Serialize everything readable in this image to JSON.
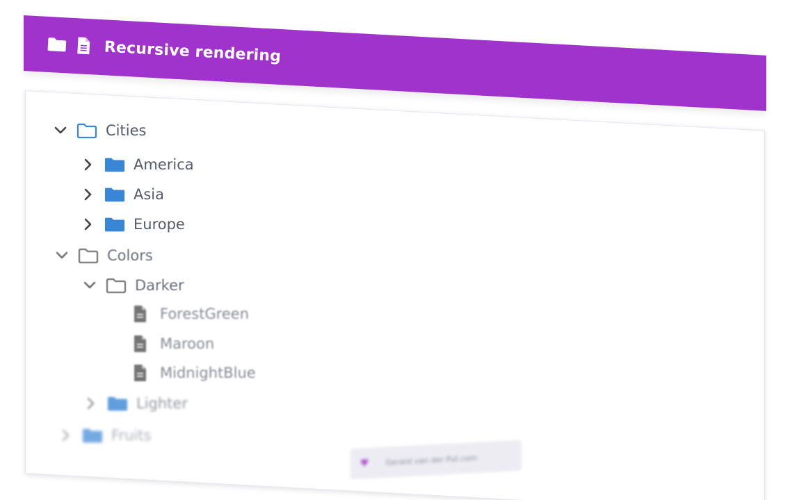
{
  "header": {
    "title": "Recursive rendering",
    "icons": [
      "folder-icon",
      "file-icon"
    ],
    "background_color": "#a033cc"
  },
  "tree": {
    "cities": {
      "label": "Cities",
      "expanded": true,
      "children": [
        {
          "label": "America",
          "expanded": false
        },
        {
          "label": "Asia",
          "expanded": false
        },
        {
          "label": "Europe",
          "expanded": false
        }
      ]
    },
    "colors": {
      "label": "Colors",
      "expanded": true,
      "darker": {
        "label": "Darker",
        "expanded": true,
        "files": [
          "ForestGreen",
          "Maroon",
          "MidnightBlue"
        ]
      },
      "lighter": {
        "label": "Lighter",
        "expanded": false
      }
    },
    "fruits": {
      "label": "Fruits",
      "expanded": false
    }
  },
  "footer": {
    "text": "Gerard van der Put.com",
    "icon": "heart-icon"
  },
  "colors": {
    "folder_blue": "#3a86d6",
    "file_gray": "#666666",
    "text": "#555a66"
  }
}
